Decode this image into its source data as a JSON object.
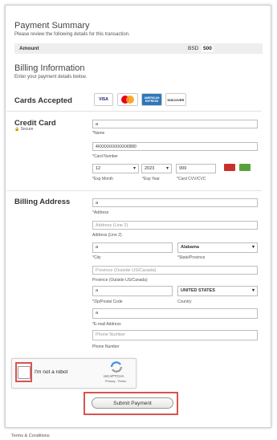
{
  "summary": {
    "title": "Payment Summary",
    "subtitle": "Please review the following details for this transaction."
  },
  "amount": {
    "label": "Amount",
    "currency": "BSD",
    "value": "500"
  },
  "billing_info": {
    "title": "Billing Information",
    "subtitle": "Enter your payment details below."
  },
  "cards_accepted": {
    "title": "Cards Accepted",
    "cards": [
      "VISA",
      "MasterCard",
      "AMERICAN EXPRESS",
      "DISCOVER"
    ]
  },
  "credit_card": {
    "title": "Credit Card",
    "secure": "Secure",
    "name_value": "a",
    "name_caption": "*Name",
    "number_value": "4XXXXXXXXXXXX0000",
    "number_caption": "*Card Number",
    "exp_month": "12",
    "exp_month_caption": "*Exp Month",
    "exp_year": "2023",
    "exp_year_caption": "*Exp Year",
    "cvv": "999",
    "cvv_caption": "*Card CVV/CVC"
  },
  "billing_address": {
    "title": "Billing Address",
    "address_value": "a",
    "address_caption": "*Address",
    "address2_placeholder": "Address (Line 2)",
    "address2_caption": "Address (Line 2)",
    "city_value": "a",
    "city_caption": "*City",
    "state_value": "Alabama",
    "state_caption": "*State/Province",
    "province_placeholder": "Province (Outside US/Canada)",
    "province_caption": "Province (Outside US/Canada)",
    "zip_value": "a",
    "zip_caption": "*Zip/Postal Code",
    "country_value": "UNITED STATES",
    "country_caption": "Country",
    "email_value": "a",
    "email_caption": "*E-mail Address",
    "phone_placeholder": "Phone Number",
    "phone_caption": "Phone Number"
  },
  "captcha": {
    "label": "I'm not a robot",
    "brand": "reCAPTCHA",
    "links": "Privacy - Terms"
  },
  "submit_label": "Submit Payment",
  "footer": {
    "terms": "Terms & Conditions"
  },
  "colors": {
    "highlight": "#d9534f",
    "bar": "#eeeeee"
  }
}
